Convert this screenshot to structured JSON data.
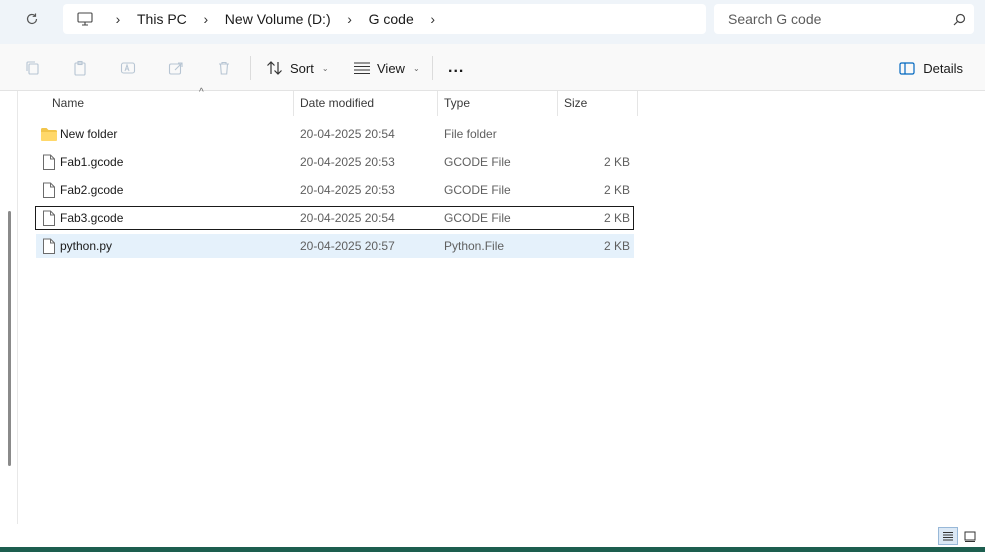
{
  "address": {
    "crumbs": [
      "This PC",
      "New Volume (D:)",
      "G code"
    ]
  },
  "search": {
    "placeholder": "Search G code"
  },
  "toolbar": {
    "sort_label": "Sort",
    "view_label": "View",
    "more_label": "...",
    "details_label": "Details"
  },
  "columns": {
    "name": "Name",
    "date": "Date modified",
    "type": "Type",
    "size": "Size"
  },
  "files": [
    {
      "name": "New folder",
      "date": "20-04-2025 20:54",
      "type": "File folder",
      "size": ""
    },
    {
      "name": "Fab1.gcode",
      "date": "20-04-2025 20:53",
      "type": "GCODE File",
      "size": "2 KB"
    },
    {
      "name": "Fab2.gcode",
      "date": "20-04-2025 20:53",
      "type": "GCODE File",
      "size": "2 KB"
    },
    {
      "name": "Fab3.gcode",
      "date": "20-04-2025 20:54",
      "type": "GCODE File",
      "size": "2 KB"
    },
    {
      "name": "python.py",
      "date": "20-04-2025 20:57",
      "type": "Python.File",
      "size": "2 KB"
    }
  ],
  "colors": {
    "accent": "#0067c0",
    "selected": "#e5f1fb",
    "folder": "#f2c54b"
  }
}
